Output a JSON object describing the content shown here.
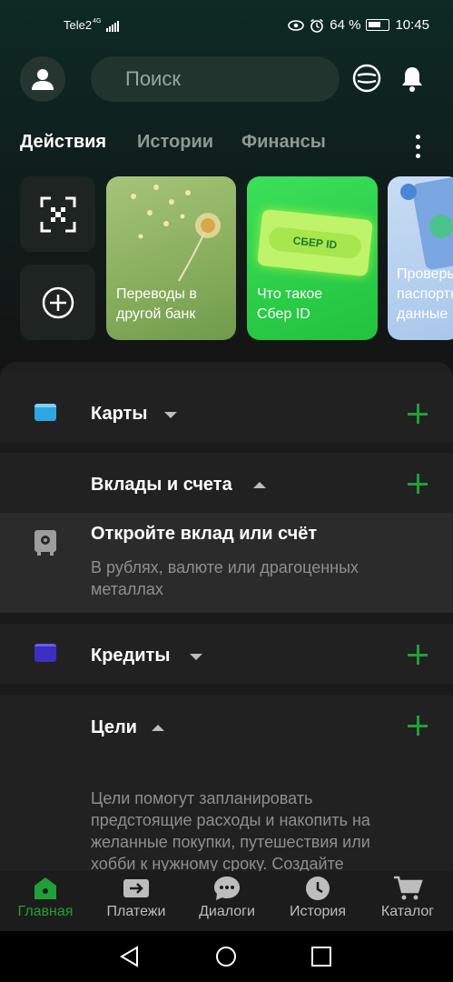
{
  "status": {
    "carrier": "Tele2",
    "network": "4G",
    "battery": "64 %",
    "time": "10:45"
  },
  "header": {
    "search_placeholder": "Поиск"
  },
  "tabs": [
    "Действия",
    "Истории",
    "Финансы"
  ],
  "stories": [
    {
      "title": "Переводы в другой банк"
    },
    {
      "title": "Что такое Сбер ID",
      "badge": "СБЕР ID"
    },
    {
      "title": "Проверьте паспортные данные"
    }
  ],
  "sections": {
    "cards": {
      "label": "Карты"
    },
    "deposits": {
      "label": "Вклады и счета",
      "promo_title": "Откройте вклад или счёт",
      "promo_text": "В рублях, валюте или драгоценных металлах"
    },
    "credits": {
      "label": "Кредиты"
    },
    "goals": {
      "label": "Цели",
      "text": "Цели помогут запланировать предстоящие расходы и накопить на желанные покупки, путешествия или хобби к нужному сроку. Создайте"
    }
  },
  "bottom_nav": [
    {
      "label": "Главная",
      "icon": "home-icon",
      "active": true
    },
    {
      "label": "Платежи",
      "icon": "payments-icon",
      "active": false
    },
    {
      "label": "Диалоги",
      "icon": "chat-icon",
      "active": false
    },
    {
      "label": "История",
      "icon": "clock-icon",
      "active": false
    },
    {
      "label": "Каталог",
      "icon": "cart-icon",
      "active": false
    }
  ],
  "colors": {
    "accent": "#21a038",
    "background": "#141414",
    "sheet": "#1f1f1f"
  }
}
